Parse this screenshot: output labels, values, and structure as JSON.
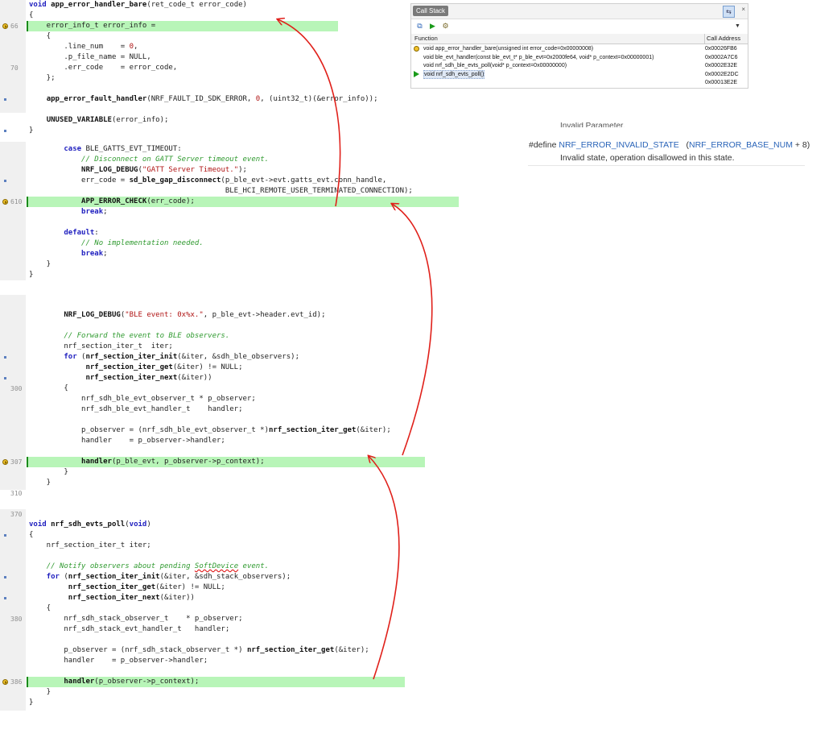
{
  "panel1": {
    "lines": [
      {
        "num": "",
        "html": "<span class='kw'>void</span> <span class='fn'>app_error_handler_bare</span>(ret_code_t error_code)"
      },
      {
        "num": "",
        "html": "{"
      },
      {
        "num": "66",
        "html": "    error_info_t error_info =",
        "hl": true,
        "pc": true
      },
      {
        "num": "",
        "html": "    {"
      },
      {
        "num": "",
        "html": "        .line_num    = <span class='num'>0</span>,"
      },
      {
        "num": "",
        "html": "        .p_file_name = NULL,"
      },
      {
        "num": "70",
        "html": "        .err_code    = error_code,"
      },
      {
        "num": "",
        "html": "    };"
      },
      {
        "num": "",
        "html": ""
      },
      {
        "num": "",
        "html": "    <span class='fn'>app_error_fault_handler</span>(NRF_FAULT_ID_SDK_ERROR, <span class='num'>0</span>, (uint32_t)(&amp;error_info));",
        "dot": true
      },
      {
        "num": "",
        "html": ""
      },
      {
        "num": "",
        "html": "    <span class='fn'>UNUSED_VARIABLE</span>(error_info);"
      },
      {
        "num": "",
        "html": "}",
        "dot": true
      }
    ]
  },
  "panel2": {
    "lines": [
      {
        "num": "",
        "html": "        <span class='kw'>case</span> BLE_GATTS_EVT_TIMEOUT:"
      },
      {
        "num": "",
        "html": "            <span class='cm'>// Disconnect on GATT Server timeout event.</span>"
      },
      {
        "num": "",
        "html": "            <span class='fn'>NRF_LOG_DEBUG</span>(<span class='st'>\"GATT Server Timeout.\"</span>);"
      },
      {
        "num": "",
        "html": "            err_code = <span class='fn'>sd_ble_gap_disconnect</span>(p_ble_evt->evt.gatts_evt.conn_handle,",
        "dot": true
      },
      {
        "num": "",
        "html": "                                             BLE_HCI_REMOTE_USER_TERMINATED_CONNECTION);"
      },
      {
        "num": "610",
        "html": "            <span class='fn'>APP_ERROR_CHECK</span>(err_code);",
        "hl": true,
        "pc": true
      },
      {
        "num": "",
        "html": "            <span class='kw'>break</span>;"
      },
      {
        "num": "",
        "html": ""
      },
      {
        "num": "",
        "html": "        <span class='kw'>default</span>:"
      },
      {
        "num": "",
        "html": "            <span class='cm'>// No implementation needed.</span>"
      },
      {
        "num": "",
        "html": "            <span class='kw'>break</span>;"
      },
      {
        "num": "",
        "html": "    }"
      },
      {
        "num": "",
        "html": "}"
      }
    ]
  },
  "panel3": {
    "lines": [
      {
        "num": "",
        "html": ""
      },
      {
        "num": "",
        "html": "        <span class='fn'>NRF_LOG_DEBUG</span>(<span class='st'>\"BLE event: 0x%x.\"</span>, p_ble_evt->header.evt_id);"
      },
      {
        "num": "",
        "html": ""
      },
      {
        "num": "",
        "html": "        <span class='cm'>// Forward the event to BLE observers.</span>"
      },
      {
        "num": "",
        "html": "        nrf_section_iter_t  iter;"
      },
      {
        "num": "",
        "html": "        <span class='kw'>for</span> (<span class='fn'>nrf_section_iter_init</span>(&amp;iter, &amp;sdh_ble_observers);",
        "dot": true
      },
      {
        "num": "",
        "html": "             <span class='fn'>nrf_section_iter_get</span>(&amp;iter) != NULL;"
      },
      {
        "num": "",
        "html": "             <span class='fn'>nrf_section_iter_next</span>(&amp;iter))",
        "dot": true
      },
      {
        "num": "300",
        "html": "        {"
      },
      {
        "num": "",
        "html": "            nrf_sdh_ble_evt_observer_t * p_observer;"
      },
      {
        "num": "",
        "html": "            nrf_sdh_ble_evt_handler_t    handler;"
      },
      {
        "num": "",
        "html": ""
      },
      {
        "num": "",
        "html": "            p_observer = (nrf_sdh_ble_evt_observer_t *)<span class='fn'>nrf_section_iter_get</span>(&amp;iter);"
      },
      {
        "num": "",
        "html": "            handler    = p_observer->handler;"
      },
      {
        "num": "",
        "html": ""
      },
      {
        "num": "307",
        "html": "            <span class='fn'>handler</span>(p_ble_evt, p_observer->p_context);",
        "hl": true,
        "pc": true
      },
      {
        "num": "",
        "html": "        }"
      },
      {
        "num": "",
        "html": "    }"
      },
      {
        "num": "310",
        "html": ""
      }
    ]
  },
  "panel4": {
    "lines": [
      {
        "num": "370",
        "html": ""
      },
      {
        "num": "",
        "html": "<span class='kw'>void</span> <span class='fn'>nrf_sdh_evts_poll</span>(<span class='kw'>void</span>)"
      },
      {
        "num": "",
        "html": "{",
        "dot": true
      },
      {
        "num": "",
        "html": "    nrf_section_iter_t iter;"
      },
      {
        "num": "",
        "html": ""
      },
      {
        "num": "",
        "html": "    <span class='cm'>// Notify observers about pending <span class='un'>SoftDevice</span> event.</span>"
      },
      {
        "num": "",
        "html": "    <span class='kw'>for</span> (<span class='fn'>nrf_section_iter_init</span>(&amp;iter, &amp;sdh_stack_observers);",
        "dot": true
      },
      {
        "num": "",
        "html": "         <span class='fn'>nrf_section_iter_get</span>(&amp;iter) != NULL;"
      },
      {
        "num": "",
        "html": "         <span class='fn'>nrf_section_iter_next</span>(&amp;iter))",
        "dot": true
      },
      {
        "num": "",
        "html": "    {"
      },
      {
        "num": "380",
        "html": "        nrf_sdh_stack_observer_t    * p_observer;"
      },
      {
        "num": "",
        "html": "        nrf_sdh_stack_evt_handler_t   handler;"
      },
      {
        "num": "",
        "html": ""
      },
      {
        "num": "",
        "html": "        p_observer = (nrf_sdh_stack_observer_t *) <span class='fn'>nrf_section_iter_get</span>(&amp;iter);"
      },
      {
        "num": "",
        "html": "        handler    = p_observer->handler;"
      },
      {
        "num": "",
        "html": ""
      },
      {
        "num": "386",
        "html": "        <span class='fn'>handler</span>(p_observer->p_context);",
        "hl": true,
        "pc": true
      },
      {
        "num": "",
        "html": "    }"
      },
      {
        "num": "",
        "html": "}"
      }
    ]
  },
  "callstack": {
    "title": "Call Stack",
    "pin": "⇆",
    "close": "×",
    "col_function": "Function",
    "col_address": "Call Address",
    "rows": [
      {
        "fn": "void app_error_handler_bare(unsigned int error_code=0x00000008)",
        "addr": "0x00026FB6",
        "icon": "current"
      },
      {
        "fn": "void ble_evt_handler(const ble_evt_t* p_ble_evt=0x2000fe64, void* p_context=0x00000001)",
        "addr": "0x0002A7C6",
        "icon": ""
      },
      {
        "fn": "void nrf_sdh_ble_evts_poll(void* p_context=0x00000000)",
        "addr": "0x0002E32E",
        "icon": ""
      },
      {
        "fn": "void nrf_sdh_evts_poll()",
        "addr": "0x0002E2DC",
        "icon": "green",
        "selected": true
      },
      {
        "fn": "",
        "addr": "0x00013E2E",
        "icon": ""
      }
    ]
  },
  "doc": {
    "cut_text": "Invalid Parameter.",
    "define_kw": "#define ",
    "define_name": "NRF_ERROR_INVALID_STATE",
    "define_paren_open": "   (",
    "define_base": "NRF_ERROR_BASE_NUM",
    "define_rest": " + 8)",
    "description": "Invalid state, operation disallowed in this state."
  },
  "colors": {
    "highlight": "#b8f5b8",
    "arrow": "#e0201a",
    "keyword": "#1f1fbf",
    "comment": "#2f9a2f",
    "string": "#b01515",
    "link": "#2a64b8"
  }
}
